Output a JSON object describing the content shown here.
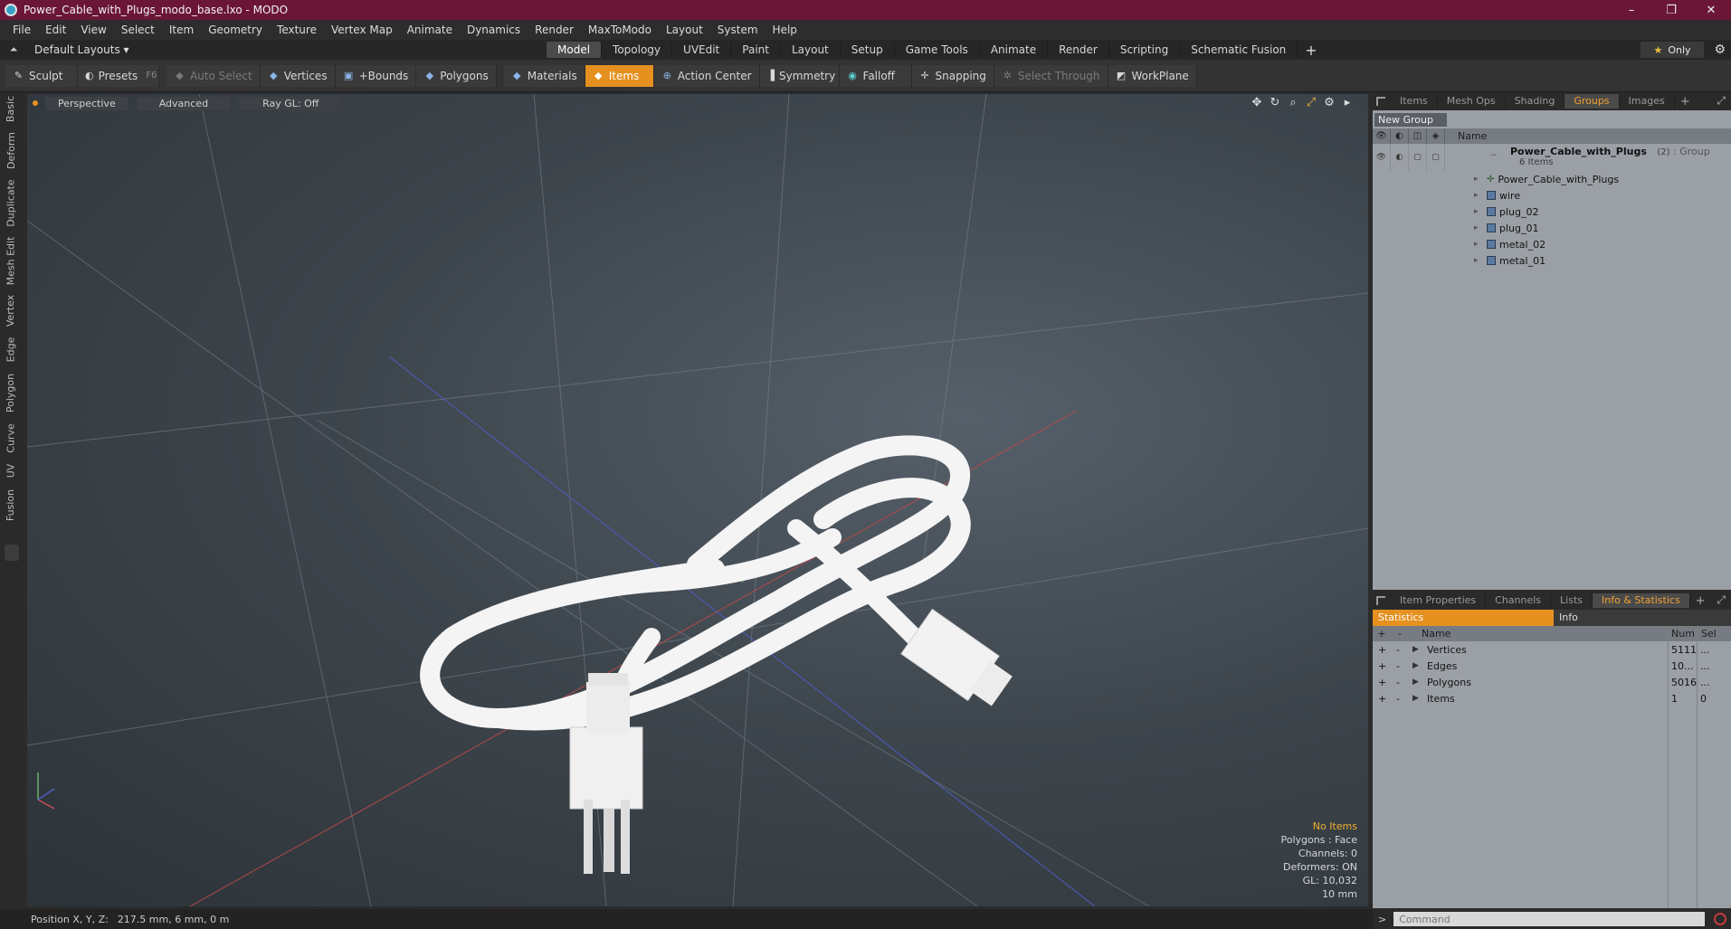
{
  "window": {
    "title": "Power_Cable_with_Plugs_modo_base.lxo - MODO",
    "controls": [
      "–",
      "❐",
      "✕"
    ]
  },
  "menu": [
    "File",
    "Edit",
    "View",
    "Select",
    "Item",
    "Geometry",
    "Texture",
    "Vertex Map",
    "Animate",
    "Dynamics",
    "Render",
    "MaxToModo",
    "Layout",
    "System",
    "Help"
  ],
  "layoutbar": {
    "layout_select": "Default Layouts ▾",
    "tabs": [
      "Model",
      "Topology",
      "UVEdit",
      "Paint",
      "Layout",
      "Setup",
      "Game Tools",
      "Animate",
      "Render",
      "Scripting",
      "Schematic Fusion"
    ],
    "active_tab": "Model",
    "only_label": "Only"
  },
  "toolbar": {
    "sculpt": "Sculpt",
    "presets": "Presets",
    "presets_key": "F6",
    "auto_select": "Auto Select",
    "vertices": "Vertices",
    "bounds": "+Bounds",
    "polygons": "Polygons",
    "materials": "Materials",
    "items": "Items",
    "action_center": "Action Center",
    "symmetry": "Symmetry",
    "falloff": "Falloff",
    "snapping": "Snapping",
    "select_through": "Select Through",
    "workplane": "WorkPlane"
  },
  "left_tabs": [
    "Basic",
    "Deform",
    "Duplicate",
    "Mesh Edit",
    "Vertex",
    "Edge",
    "Polygon",
    "Curve",
    "UV",
    "Fusion"
  ],
  "viewport": {
    "perspective": "Perspective",
    "advanced": "Advanced",
    "raygl": "Ray GL: Off",
    "info": {
      "no_items": "No Items",
      "polygons": "Polygons : Face",
      "channels": "Channels: 0",
      "deformers": "Deformers: ON",
      "gl": "GL: 10,032",
      "scale": "10 mm"
    }
  },
  "status": {
    "position_label": "Position X, Y, Z:",
    "position_value": "217.5 mm, 6 mm, 0 m"
  },
  "upper_panel": {
    "tabs": [
      "Items",
      "Mesh Ops",
      "Shading",
      "Groups",
      "Images"
    ],
    "active_tab": "Groups",
    "new_group": "New Group",
    "name_header": "Name",
    "group": {
      "name": "Power_Cable_with_Plugs",
      "count": "(2)",
      "type": ": Group",
      "items_count": "6 Items"
    },
    "children": [
      "Power_Cable_with_Plugs",
      "wire",
      "plug_02",
      "plug_01",
      "metal_02",
      "metal_01"
    ]
  },
  "lower_panel": {
    "tabs": [
      "Item Properties",
      "Channels",
      "Lists",
      "Info & Statistics"
    ],
    "active_tab": "Info & Statistics",
    "sub_tabs": [
      "Statistics",
      "Info"
    ],
    "headers": {
      "name": "Name",
      "num": "Num",
      "sel": "Sel"
    },
    "rows": [
      {
        "name": "Vertices",
        "num": "5111",
        "sel": "..."
      },
      {
        "name": "Edges",
        "num": "10...",
        "sel": "..."
      },
      {
        "name": "Polygons",
        "num": "5016",
        "sel": "..."
      },
      {
        "name": "Items",
        "num": "1",
        "sel": "0"
      }
    ]
  },
  "command": {
    "placeholder": "Command"
  }
}
